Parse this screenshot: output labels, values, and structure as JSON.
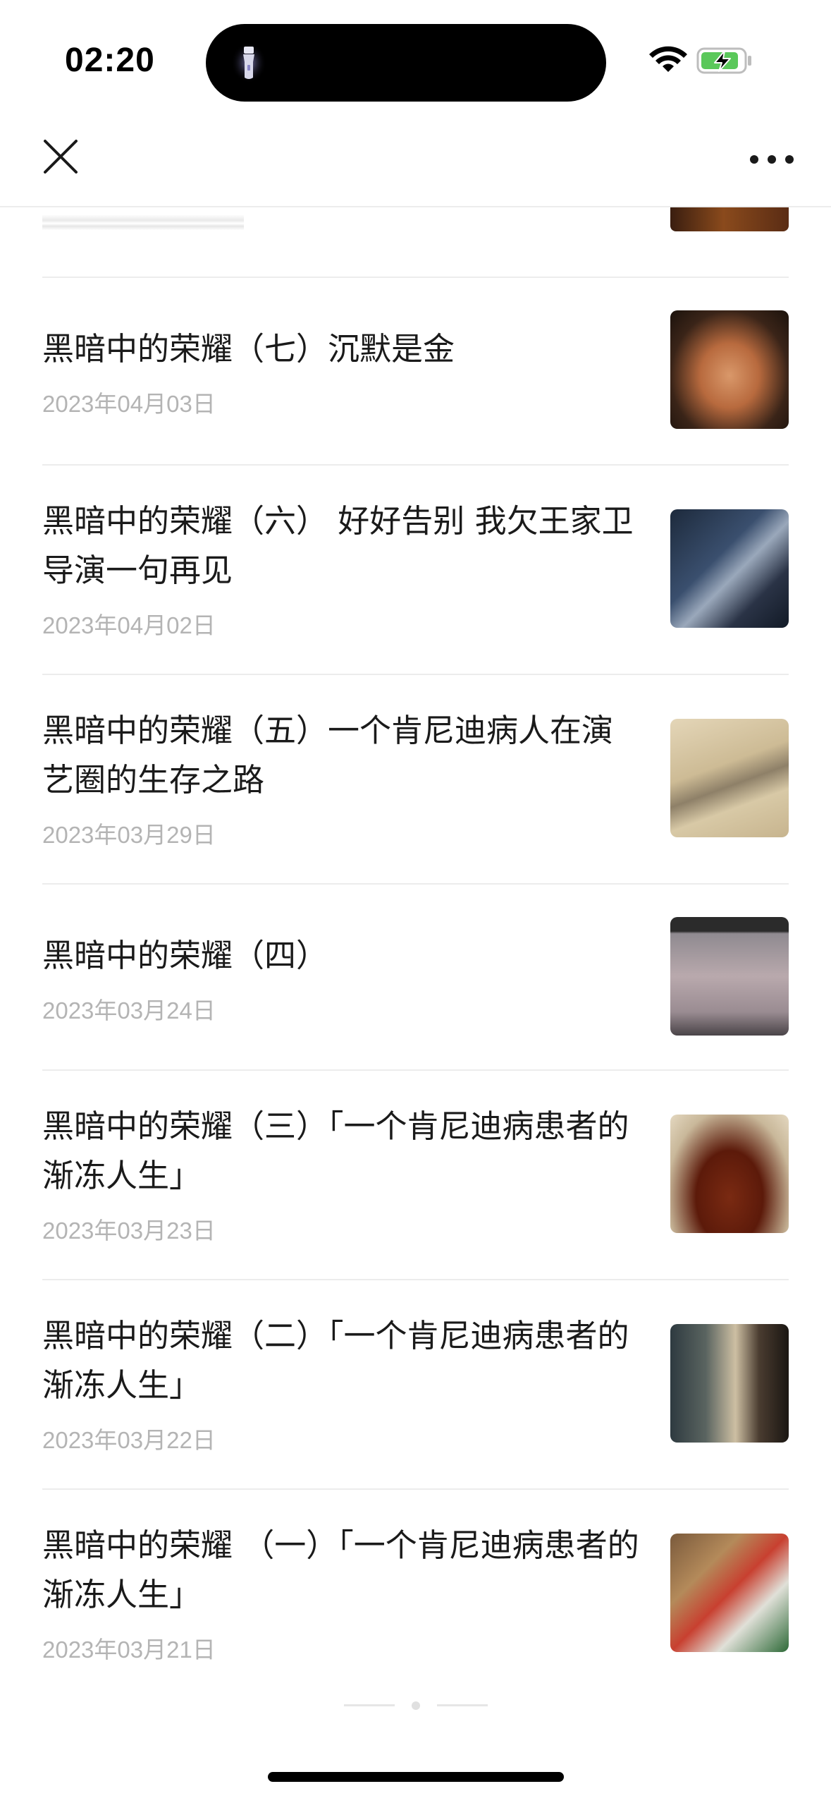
{
  "status_bar": {
    "time": "02:20",
    "icons": [
      "flashlight-icon",
      "wifi-icon",
      "battery-charging-icon"
    ],
    "battery_color": "#5ac85a"
  },
  "nav_bar": {
    "close_icon": "close-icon",
    "more_icon": "more-icon"
  },
  "articles": [
    {
      "title": "黑暗中的荣耀（七）沉默是金",
      "date": "2023年04月03日"
    },
    {
      "title": "黑暗中的荣耀（六） 好好告别 我欠王家卫导演一句再见",
      "date": "2023年04月02日"
    },
    {
      "title": "黑暗中的荣耀（五）一个肯尼迪病人在演艺圈的生存之路",
      "date": "2023年03月29日"
    },
    {
      "title": "黑暗中的荣耀（四）",
      "date": "2023年03月24日"
    },
    {
      "title": "黑暗中的荣耀（三）「一个肯尼迪病患者的渐冻人生」",
      "date": "2023年03月23日"
    },
    {
      "title": "黑暗中的荣耀（二）「一个肯尼迪病患者的渐冻人生」",
      "date": "2023年03月22日"
    },
    {
      "title": "黑暗中的荣耀 （一）「一个肯尼迪病患者的渐冻人生」",
      "date": "2023年03月21日"
    }
  ]
}
